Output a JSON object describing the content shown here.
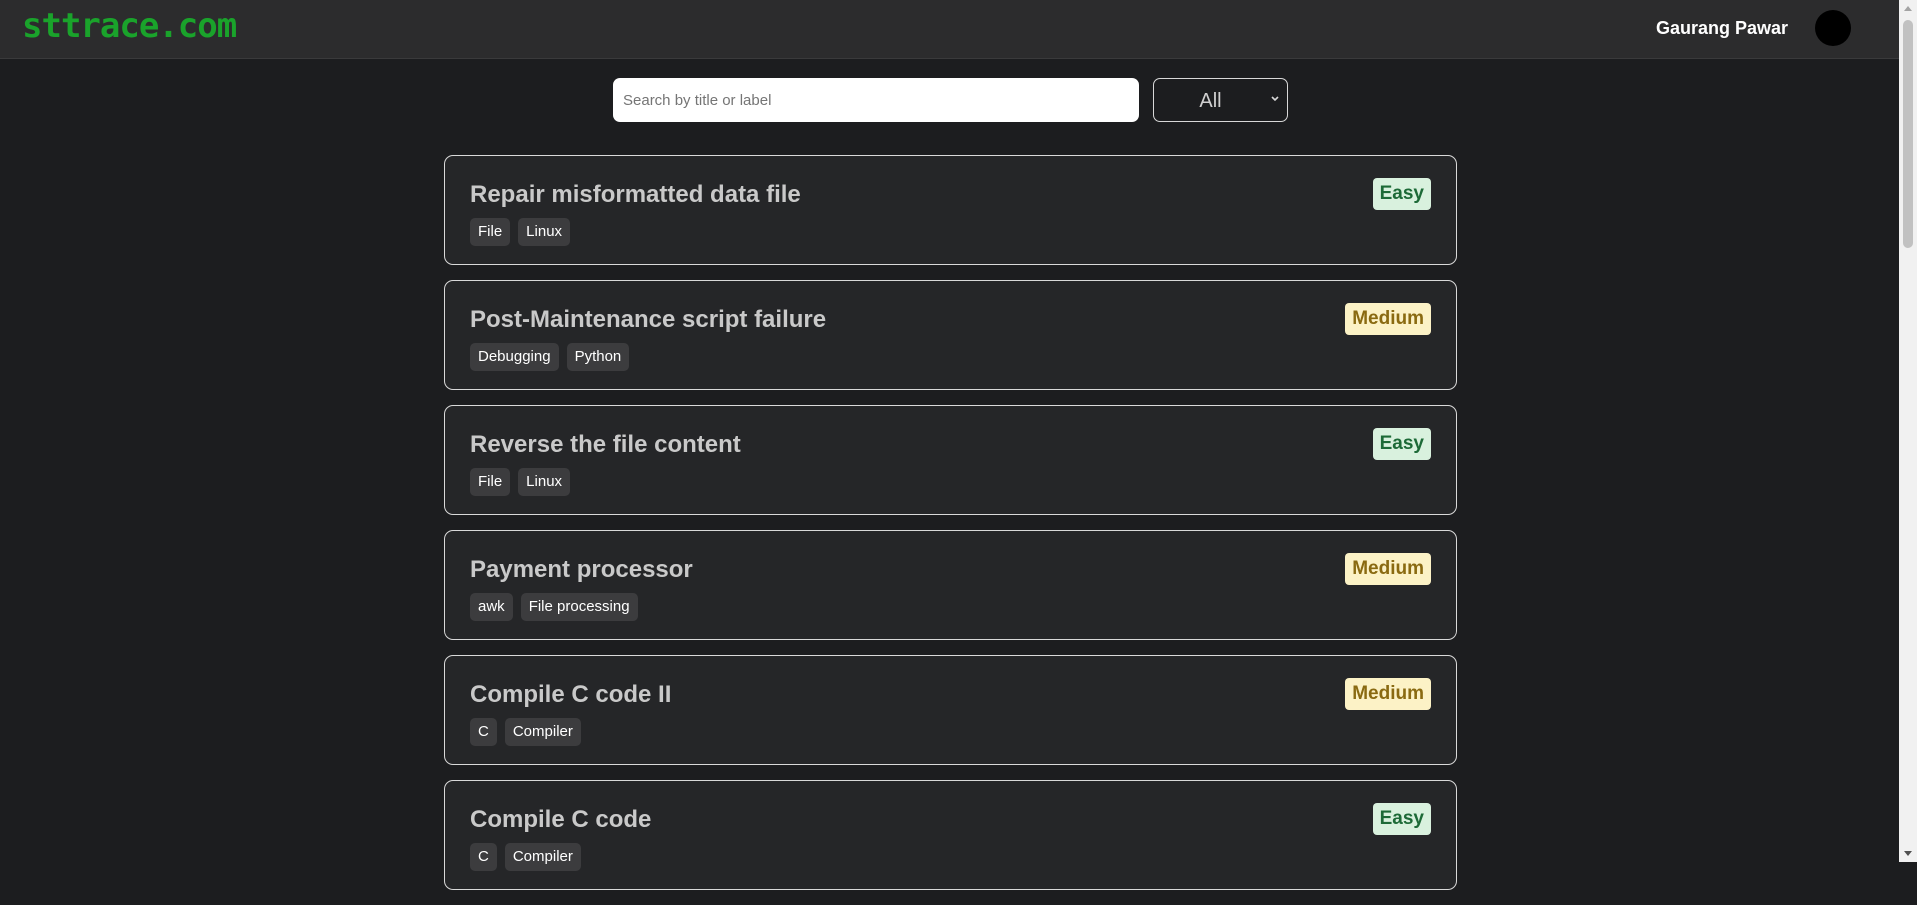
{
  "header": {
    "logo": "sttrace.com",
    "user_name": "Gaurang Pawar"
  },
  "search": {
    "placeholder": "Search by title or label",
    "value": ""
  },
  "filter": {
    "selected": "All"
  },
  "colors": {
    "background": "#1c1d1f",
    "logo": "#1aa32b",
    "easy_badge_bg": "#d9f1de",
    "easy_badge_text": "#1d6a37",
    "medium_badge_bg": "#fcf2c6",
    "medium_badge_text": "#8a6a11"
  },
  "problems": [
    {
      "title": "Repair misformatted data file",
      "difficulty": "Easy",
      "tags": [
        "File",
        "Linux"
      ]
    },
    {
      "title": "Post-Maintenance script failure",
      "difficulty": "Medium",
      "tags": [
        "Debugging",
        "Python"
      ]
    },
    {
      "title": "Reverse the file content",
      "difficulty": "Easy",
      "tags": [
        "File",
        "Linux"
      ]
    },
    {
      "title": "Payment processor",
      "difficulty": "Medium",
      "tags": [
        "awk",
        "File processing"
      ]
    },
    {
      "title": "Compile C code II",
      "difficulty": "Medium",
      "tags": [
        "C",
        "Compiler"
      ]
    },
    {
      "title": "Compile C code",
      "difficulty": "Easy",
      "tags": [
        "C",
        "Compiler"
      ]
    }
  ]
}
